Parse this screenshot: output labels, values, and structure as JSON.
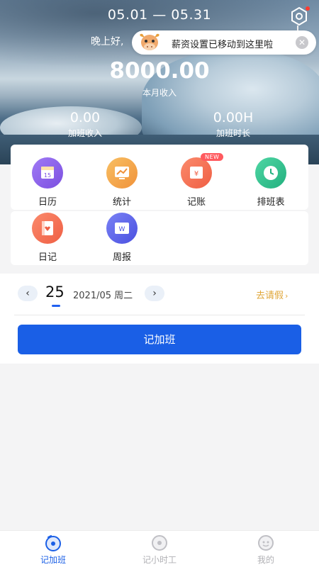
{
  "header": {
    "date_range": "05.01 — 05.31",
    "greeting": "晚上好,",
    "tip_text": "薪资设置已移动到这里啦",
    "income_amount": "8000.00",
    "income_label": "本月收入",
    "overtime_income_value": "0.00",
    "overtime_income_label": "加班收入",
    "overtime_hours_value": "0.00H",
    "overtime_hours_label": "加班时长"
  },
  "features": {
    "row1": [
      {
        "label": "日历",
        "icon": "calendar-icon",
        "color": "#8a63e8"
      },
      {
        "label": "统计",
        "icon": "chart-icon",
        "color": "#f3a040"
      },
      {
        "label": "记账",
        "icon": "ledger-icon",
        "color": "#f06a4f",
        "badge": "NEW"
      },
      {
        "label": "排班表",
        "icon": "clock-icon",
        "color": "#2fbf8f"
      }
    ],
    "row2": [
      {
        "label": "日记",
        "icon": "diary-icon",
        "color": "#f0704f"
      },
      {
        "label": "周报",
        "icon": "weekly-report-icon",
        "color": "#5a63e6"
      }
    ]
  },
  "date_picker": {
    "day": "25",
    "date_text": "2021/05 周二",
    "leave_link": "去请假",
    "prev_glyph": "‹",
    "next_glyph": "›",
    "leave_arrow": "›"
  },
  "actions": {
    "primary_button": "记加班"
  },
  "bottom_nav": {
    "tabs": [
      {
        "label": "记加班",
        "icon": "overtime-icon",
        "active": true
      },
      {
        "label": "记小时工",
        "icon": "hourly-icon",
        "active": false
      },
      {
        "label": "我的",
        "icon": "profile-icon",
        "active": false
      }
    ]
  },
  "colors": {
    "primary": "#1a5fe6",
    "accent_link": "#e0a73a",
    "badge": "#ff5a5f"
  }
}
